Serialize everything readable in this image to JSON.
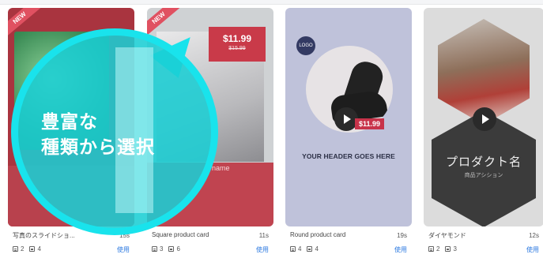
{
  "cards": [
    {
      "badge": "NEW",
      "title": "写真のスライドショ...",
      "duration": "15s",
      "text_count": "2",
      "image_count": "4",
      "use_label": "使用"
    },
    {
      "badge": "NEW",
      "price": "$11.99",
      "old_price": "$15.99",
      "band_text": "name",
      "title": "Square product card",
      "duration": "11s",
      "text_count": "3",
      "image_count": "6",
      "use_label": "使用"
    },
    {
      "logo_text": "LOGO",
      "price_tag": "$11.99",
      "header_text": "YOUR HEADER GOES HERE",
      "title": "Round product card",
      "duration": "19s",
      "text_count": "4",
      "image_count": "4",
      "use_label": "使用"
    },
    {
      "product_name": "プロダクト名",
      "product_sub": "商品アシション",
      "title": "ダイヤモンド",
      "duration": "12s",
      "text_count": "2",
      "image_count": "3",
      "use_label": "使用"
    }
  ],
  "overlay": {
    "line1": "豊富な",
    "line2": "種類から選択",
    "color": "#19e3ec"
  }
}
